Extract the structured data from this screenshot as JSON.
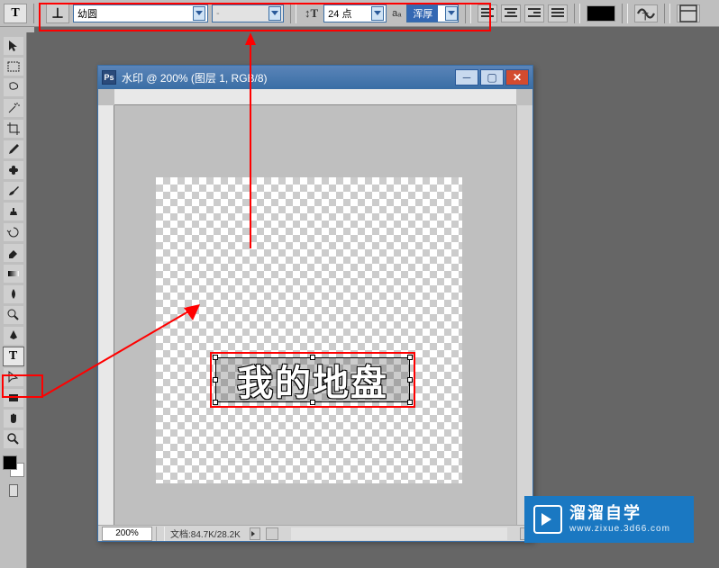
{
  "toolbar_options": {
    "tool_glyph": "T",
    "orientation_glyph": "⸆T",
    "font_family": "幼圆",
    "font_style": "-",
    "size_icon": "T",
    "font_size": "24 点",
    "aa_label": "aₐ",
    "aa_value": "浑厚",
    "color": "#000000"
  },
  "tools": [
    {
      "name": "move-tool",
      "glyph": "↖"
    },
    {
      "name": "marquee-tool",
      "glyph": "▭"
    },
    {
      "name": "lasso-tool",
      "glyph": "ᔕ"
    },
    {
      "name": "magic-wand-tool",
      "glyph": "✶"
    },
    {
      "name": "crop-tool",
      "glyph": "✂"
    },
    {
      "name": "eyedropper-tool",
      "glyph": "✎"
    },
    {
      "name": "healing-brush-tool",
      "glyph": "✚"
    },
    {
      "name": "brush-tool",
      "glyph": "🖌"
    },
    {
      "name": "clone-stamp-tool",
      "glyph": "⍒"
    },
    {
      "name": "history-brush-tool",
      "glyph": "↺"
    },
    {
      "name": "eraser-tool",
      "glyph": "◧"
    },
    {
      "name": "gradient-tool",
      "glyph": "▤"
    },
    {
      "name": "blur-tool",
      "glyph": "💧"
    },
    {
      "name": "dodge-tool",
      "glyph": "🔍"
    },
    {
      "name": "pen-tool",
      "glyph": "✒"
    },
    {
      "name": "type-tool",
      "glyph": "T",
      "active": true
    },
    {
      "name": "path-selection-tool",
      "glyph": "↖"
    },
    {
      "name": "shape-tool",
      "glyph": "▭"
    },
    {
      "name": "hand-tool",
      "glyph": "✋"
    },
    {
      "name": "zoom-tool",
      "glyph": "🔍"
    }
  ],
  "document": {
    "title": "水印 @ 200% (图层 1, RGB/8)",
    "zoom": "200%",
    "status_doc": "文档:84.7K/28.2K",
    "canvas_text": "我的地盘"
  },
  "watermark": {
    "title": "溜溜自学",
    "url": "www.zixue.3d66.com"
  }
}
